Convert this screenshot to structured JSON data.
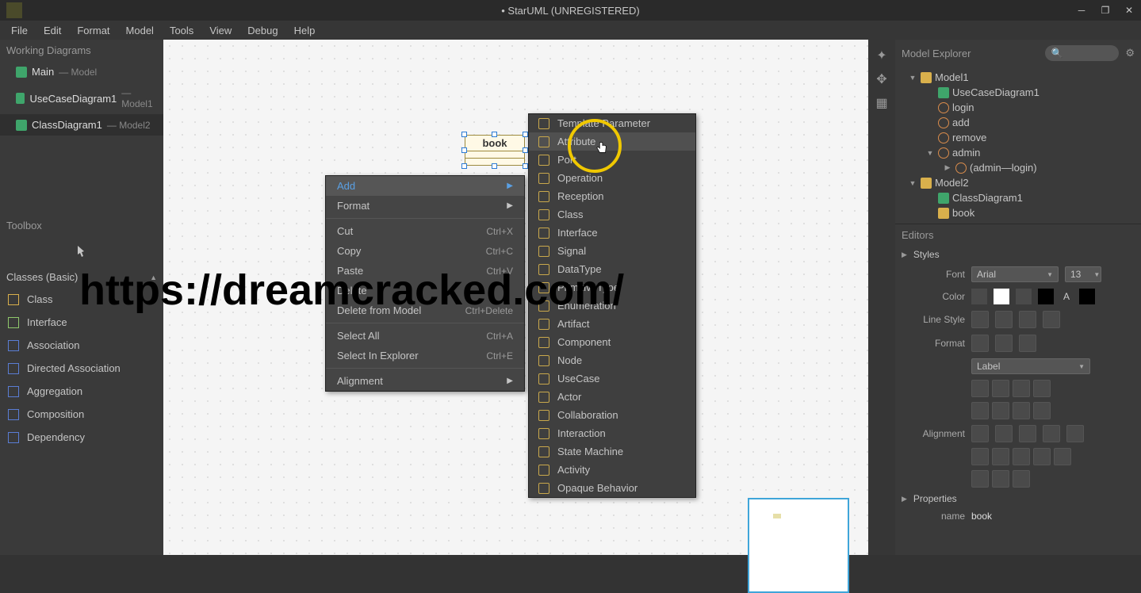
{
  "title": "• StarUML (UNREGISTERED)",
  "menubar": [
    "File",
    "Edit",
    "Format",
    "Model",
    "Tools",
    "View",
    "Debug",
    "Help"
  ],
  "workingDiagrams": {
    "head": "Working Diagrams",
    "items": [
      {
        "name": "Main",
        "sub": "— Model"
      },
      {
        "name": "UseCaseDiagram1",
        "sub": "— Model1"
      },
      {
        "name": "ClassDiagram1",
        "sub": "— Model2"
      }
    ]
  },
  "toolbox": {
    "head": "Toolbox",
    "section": "Classes (Basic)",
    "items": [
      "Class",
      "Interface",
      "Association",
      "Directed Association",
      "Aggregation",
      "Composition",
      "Dependency"
    ]
  },
  "umlClass": {
    "name": "book"
  },
  "ctxMenu": {
    "items": [
      {
        "label": "Add",
        "arrow": true,
        "hl": true
      },
      {
        "label": "Format",
        "arrow": true
      },
      {
        "sep": true
      },
      {
        "label": "Cut",
        "short": "Ctrl+X"
      },
      {
        "label": "Copy",
        "short": "Ctrl+C"
      },
      {
        "label": "Paste",
        "short": "Ctrl+V"
      },
      {
        "label": "Delete"
      },
      {
        "label": "Delete from Model",
        "short": "Ctrl+Delete"
      },
      {
        "sep": true
      },
      {
        "label": "Select All",
        "short": "Ctrl+A"
      },
      {
        "label": "Select In Explorer",
        "short": "Ctrl+E"
      },
      {
        "sep": true
      },
      {
        "label": "Alignment",
        "arrow": true
      }
    ]
  },
  "submenu": {
    "items": [
      "Template Parameter",
      "Attribute",
      "Port",
      "Operation",
      "Reception",
      "Class",
      "Interface",
      "Signal",
      "DataType",
      "PrimitiveType",
      "Enumeration",
      "Artifact",
      "Component",
      "Node",
      "UseCase",
      "Actor",
      "Collaboration",
      "Interaction",
      "State Machine",
      "Activity",
      "Opaque Behavior"
    ],
    "hovIndex": 1
  },
  "modelExplorer": {
    "head": "Model Explorer",
    "tree": [
      {
        "indent": 0,
        "chev": "▼",
        "icon": "#d9b04c",
        "label": "Model1"
      },
      {
        "indent": 1,
        "chev": "",
        "icon": "#3fa56b",
        "label": "UseCaseDiagram1"
      },
      {
        "indent": 1,
        "chev": "",
        "icon": "#d98c4c",
        "label": "login",
        "circle": true
      },
      {
        "indent": 1,
        "chev": "",
        "icon": "#d98c4c",
        "label": "add",
        "circle": true
      },
      {
        "indent": 1,
        "chev": "",
        "icon": "#d98c4c",
        "label": "remove",
        "circle": true
      },
      {
        "indent": 1,
        "chev": "▼",
        "icon": "#d98c4c",
        "label": "admin",
        "circle": true
      },
      {
        "indent": 2,
        "chev": "▶",
        "icon": "#d98c4c",
        "label": "(admin—login)",
        "circle": true
      },
      {
        "indent": 0,
        "chev": "▼",
        "icon": "#d9b04c",
        "label": "Model2"
      },
      {
        "indent": 1,
        "chev": "",
        "icon": "#3fa56b",
        "label": "ClassDiagram1"
      },
      {
        "indent": 1,
        "chev": "",
        "icon": "#d9b04c",
        "label": "book"
      }
    ]
  },
  "editors": {
    "head": "Editors",
    "stylesLabel": "Styles",
    "font": {
      "label": "Font",
      "family": "Arial",
      "size": "13"
    },
    "color": {
      "label": "Color"
    },
    "lineStyle": {
      "label": "Line Style"
    },
    "format": {
      "label": "Format",
      "dropdown": "Label"
    },
    "alignment": {
      "label": "Alignment"
    },
    "propertiesLabel": "Properties",
    "name": {
      "label": "name",
      "value": "book"
    }
  },
  "watermark": "https://dreamcracked.com/"
}
